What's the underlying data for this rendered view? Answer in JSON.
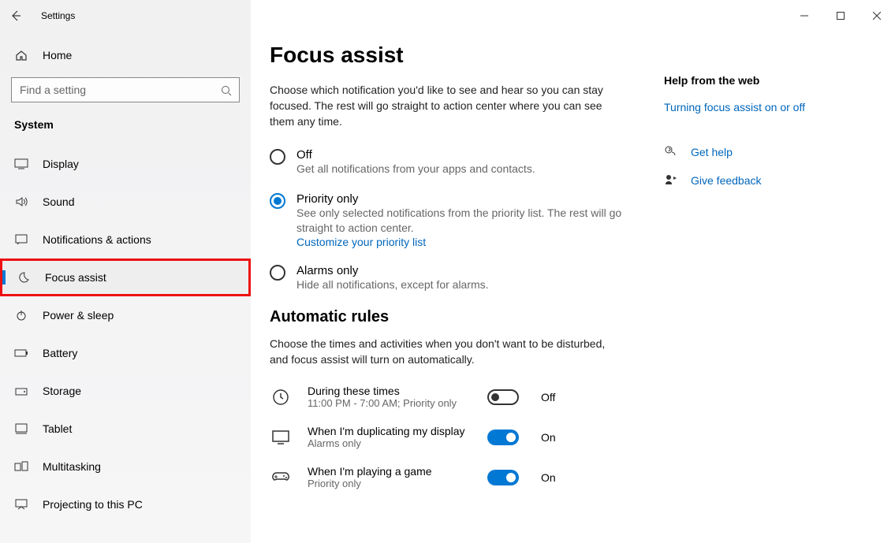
{
  "window": {
    "title": "Settings"
  },
  "sidebar": {
    "home": "Home",
    "search_placeholder": "Find a setting",
    "section": "System",
    "items": [
      {
        "label": "Display"
      },
      {
        "label": "Sound"
      },
      {
        "label": "Notifications & actions"
      },
      {
        "label": "Focus assist"
      },
      {
        "label": "Power & sleep"
      },
      {
        "label": "Battery"
      },
      {
        "label": "Storage"
      },
      {
        "label": "Tablet"
      },
      {
        "label": "Multitasking"
      },
      {
        "label": "Projecting to this PC"
      }
    ]
  },
  "page": {
    "title": "Focus assist",
    "description": "Choose which notification you'd like to see and hear so you can stay focused. The rest will go straight to action center where you can see them any time.",
    "options": [
      {
        "title": "Off",
        "sub": "Get all notifications from your apps and contacts."
      },
      {
        "title": "Priority only",
        "sub": "See only selected notifications from the priority list. The rest will go straight to action center.",
        "link": "Customize your priority list"
      },
      {
        "title": "Alarms only",
        "sub": "Hide all notifications, except for alarms."
      }
    ],
    "rules_heading": "Automatic rules",
    "rules_desc": "Choose the times and activities when you don't want to be disturbed, and focus assist will turn on automatically.",
    "rules": [
      {
        "title": "During these times",
        "sub": "11:00 PM - 7:00 AM; Priority only",
        "state": "Off"
      },
      {
        "title": "When I'm duplicating my display",
        "sub": "Alarms only",
        "state": "On"
      },
      {
        "title": "When I'm playing a game",
        "sub": "Priority only",
        "state": "On"
      }
    ]
  },
  "right": {
    "heading": "Help from the web",
    "link": "Turning focus assist on or off",
    "help": "Get help",
    "feedback": "Give feedback"
  }
}
